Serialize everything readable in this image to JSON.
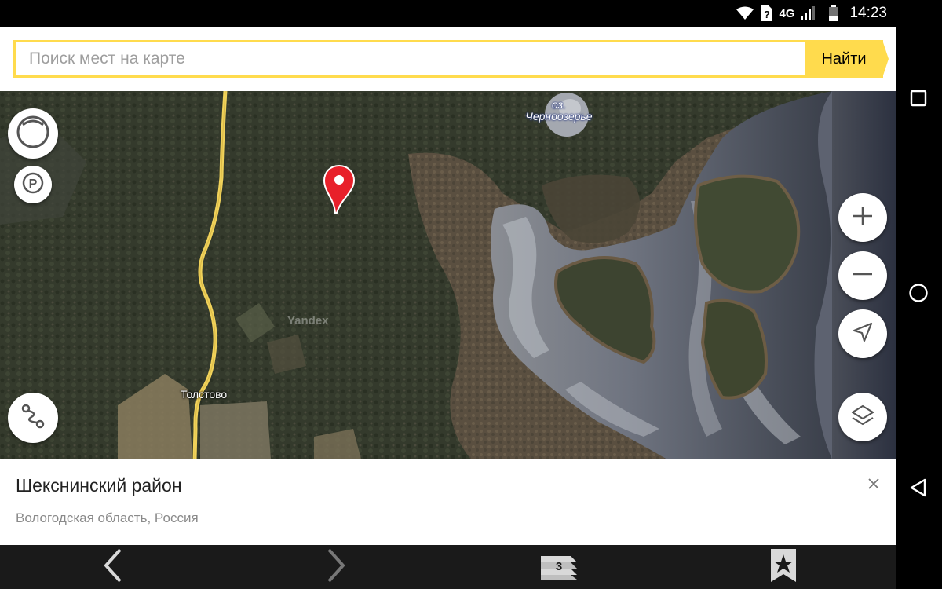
{
  "status_bar": {
    "network": "4G",
    "time": "14:23"
  },
  "search": {
    "placeholder": "Поиск мест на карте",
    "button_label": "Найти"
  },
  "map": {
    "lake_label_line1": "оз.",
    "lake_label_line2": "Черноозерье",
    "village_label": "Толстово",
    "watermark": "Yandex",
    "controls": {
      "left": [
        "traffic-icon",
        "parking-icon",
        "route-icon"
      ],
      "right": [
        "zoom-in-icon",
        "zoom-out-icon",
        "location-arrow-icon",
        "layers-icon"
      ]
    }
  },
  "place_card": {
    "title": "Шекснинский район",
    "subtitle": "Вологодская область, Россия"
  },
  "bottom_bar": {
    "tabs_count": "3"
  },
  "colors": {
    "accent": "#ffdb4d",
    "pin": "#e8202a",
    "road": "#f0d25a"
  }
}
